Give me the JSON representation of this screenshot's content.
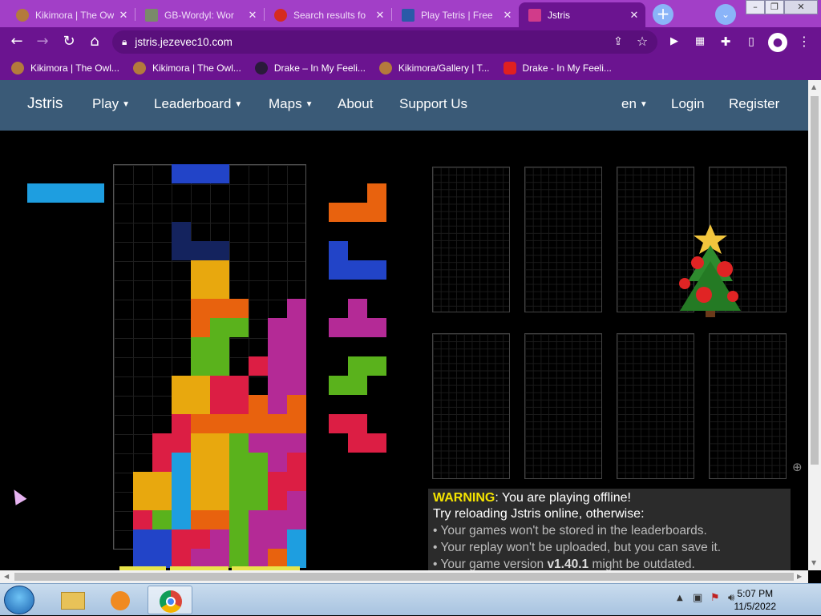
{
  "browser": {
    "tabs": [
      {
        "title": "Kikimora | The Ow",
        "favicon_color": "#b47a3c"
      },
      {
        "title": "GB-Wordyl: Wor",
        "favicon_color": "#7a8a6a"
      },
      {
        "title": "Search results fo",
        "favicon_color": "#d62b1f"
      },
      {
        "title": "Play Tetris | Free",
        "favicon_color": "#2a5aa8"
      },
      {
        "title": "Jstris",
        "favicon_color": "#d13b8a"
      }
    ],
    "active_tab_index": 4,
    "url": "jstris.jezevec10.com",
    "bookmarks": [
      {
        "label": "Kikimora | The Owl...",
        "icon_color": "#b47a3c"
      },
      {
        "label": "Kikimora | The Owl...",
        "icon_color": "#b47a3c"
      },
      {
        "label": "Drake – In My Feeli...",
        "icon_color": "#2a1a3a"
      },
      {
        "label": "Kikimora/Gallery | T...",
        "icon_color": "#b47a3c"
      },
      {
        "label": "Drake - In My Feeli...",
        "icon_color": "#e02020"
      }
    ]
  },
  "site": {
    "brand": "Jstris",
    "nav": {
      "play": "Play",
      "leaderboard": "Leaderboard",
      "maps": "Maps",
      "about": "About",
      "support": "Support Us",
      "language": "en",
      "login": "Login",
      "register": "Register"
    }
  },
  "game": {
    "colors": {
      "I": "#1e9ee0",
      "J": "#2244c8",
      "L": "#e8620e",
      "O": "#e8a80e",
      "S": "#5ab21c",
      "T": "#b42a96",
      "Z": "#dc1e44",
      "ghost": "#14235e"
    },
    "hold": "I",
    "queue": [
      "L",
      "J",
      "T",
      "S",
      "Z"
    ],
    "board_rows": [
      "...JJJ....",
      "..........",
      "..........",
      "...G......",
      "...GGG....",
      "....OO....",
      "....OO....",
      "....LLL..T",
      "....LSS.TT",
      "....SS..TT",
      "....SS.ZTT",
      "...OOZZ.TT",
      "...OOZZLTL",
      "...ZLLLLLL",
      "..ZZOOSTTT",
      "..ZIOOSSTZ",
      ".OOIOOSSZZ",
      ".OOIOOSSZT",
      ".ZSILLSTTT",
      ".JJZZTSTTI",
      ".JJZTTSTLI"
    ]
  },
  "warning": {
    "label": "WARNING",
    "headline": ": You are playing offline!",
    "line2": "Try reloading Jstris online, otherwise:",
    "bullet1": "• Your games won't be stored in the leaderboards.",
    "bullet2": "• Your replay won't be uploaded, but you can save it.",
    "bullet3_pre": "• Your game version ",
    "bullet3_version": "v1.40.1",
    "bullet3_post": " might be outdated."
  },
  "taskbar": {
    "time": "5:07 PM",
    "date": "11/5/2022"
  }
}
